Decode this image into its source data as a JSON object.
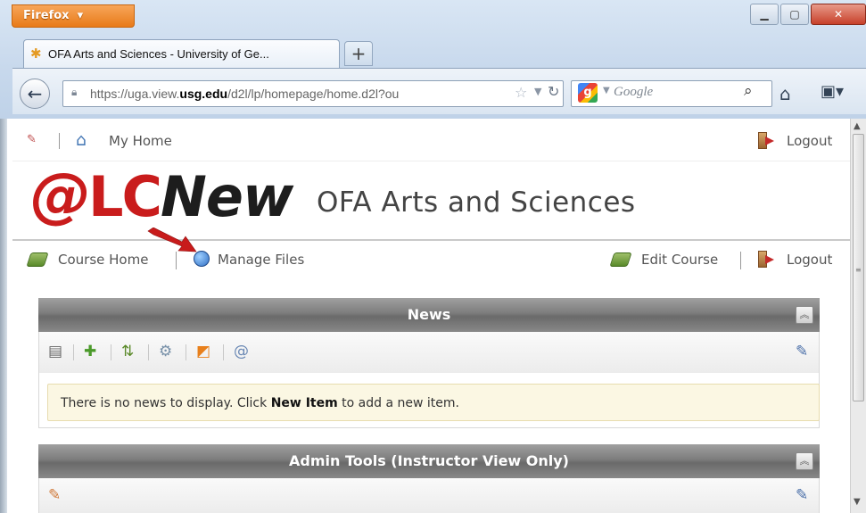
{
  "browser": {
    "app_menu": "Firefox",
    "tab_title": "OFA Arts and Sciences - University of Ge...",
    "new_tab_label": "+",
    "url_prefix": "https://uga.view.",
    "url_host": "usg.edu",
    "url_suffix": "/d2l/lp/homepage/home.d2l?ou",
    "search_engine": "Google"
  },
  "page": {
    "top_nav": {
      "my_home": "My Home",
      "logout": "Logout"
    },
    "logo": {
      "at": "@",
      "lc": "LC",
      "new": "New"
    },
    "course_title": "OFA Arts and Sciences",
    "course_nav": {
      "course_home": "Course Home",
      "manage_files": "Manage Files",
      "edit_course": "Edit Course",
      "logout": "Logout"
    },
    "news": {
      "title": "News",
      "message_before": "There is no news to display. Click ",
      "message_link": "New Item",
      "message_after": " to add a new item."
    },
    "admin_tools": {
      "title": "Admin Tools (Instructor View Only)"
    }
  },
  "colors": {
    "accent_red": "#c91c1c",
    "widget_header": "#7c7c7c",
    "firefox_orange": "#e87a18",
    "news_notice_bg": "#fbf7e3"
  }
}
